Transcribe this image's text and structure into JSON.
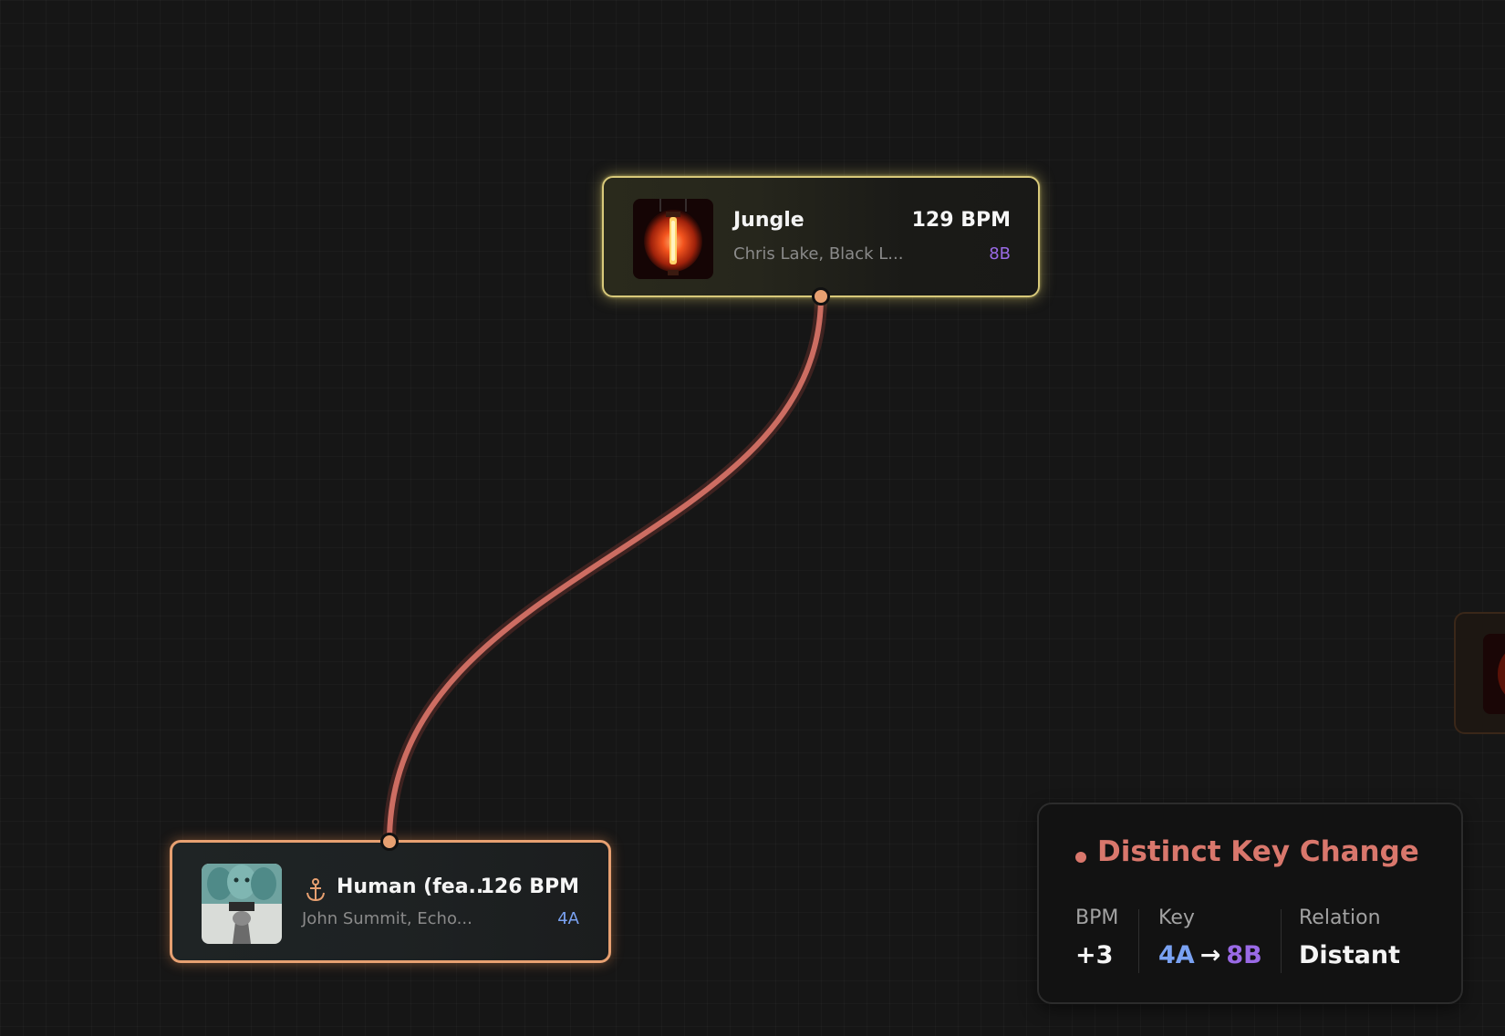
{
  "colors": {
    "edge": "#cd6d62",
    "edge_glow": "#5a2b28",
    "jungle_border": "#d8c97a",
    "human_border": "#e7a071",
    "key_4a": "#7aa2f2",
    "key_8b": "#9a6ae6",
    "warning": "#d9776c"
  },
  "nodes": {
    "jungle": {
      "title": "Jungle",
      "artist": "Chris Lake, Black L...",
      "bpm": "129 BPM",
      "key": "8B",
      "art_icon": "red-lantern-artwork"
    },
    "human": {
      "title": "Human (fea...",
      "artist": "John Summit, Echo...",
      "bpm": "126 BPM",
      "key": "4A",
      "anchor_icon": "anchor-icon",
      "art_icon": "faces-collage-artwork"
    }
  },
  "transition": {
    "title": "Distinct Key Change",
    "bpm_label": "BPM",
    "bpm_value": "+3",
    "key_label": "Key",
    "key_from": "4A",
    "key_arrow": "→",
    "key_to": "8B",
    "relation_label": "Relation",
    "relation_value": "Distant"
  }
}
